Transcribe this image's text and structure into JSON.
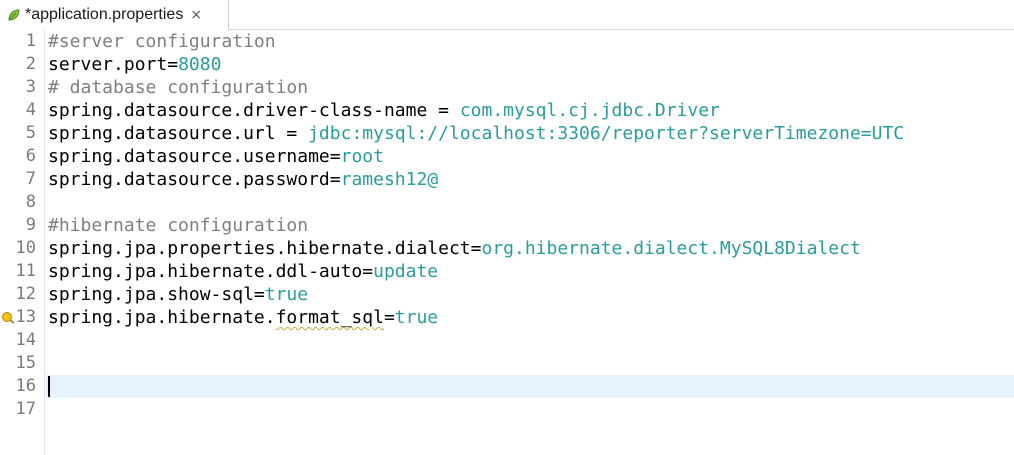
{
  "tab": {
    "title": "*application.properties",
    "close_glyph": "×",
    "icon": "properties-file-icon"
  },
  "lines": [
    {
      "n": "1",
      "comment": "#server configuration"
    },
    {
      "n": "2",
      "key": "server.port",
      "sep": "=",
      "value": "8080"
    },
    {
      "n": "3",
      "comment": "# database configuration"
    },
    {
      "n": "4",
      "key": "spring.datasource.driver-class-name",
      "sep": " = ",
      "value": "com.mysql.cj.jdbc.Driver"
    },
    {
      "n": "5",
      "key": "spring.datasource.url",
      "sep": " = ",
      "value": "jdbc:mysql://localhost:3306/reporter?serverTimezone=UTC"
    },
    {
      "n": "6",
      "key": "spring.datasource.username",
      "sep": "=",
      "value": "root"
    },
    {
      "n": "7",
      "key": "spring.datasource.password",
      "sep": "=",
      "value": "ramesh12@"
    },
    {
      "n": "8"
    },
    {
      "n": "9",
      "comment": "#hibernate configuration"
    },
    {
      "n": "10",
      "key": "spring.jpa.properties.hibernate.dialect",
      "sep": "=",
      "value": "org.hibernate.dialect.MySQL8Dialect"
    },
    {
      "n": "11",
      "key": "spring.jpa.hibernate.ddl-auto",
      "sep": "=",
      "value": "update"
    },
    {
      "n": "12",
      "key": "spring.jpa.show-sql",
      "sep": "=",
      "value": "true"
    },
    {
      "n": "13",
      "key_prefix": "spring.jpa.hibernate.",
      "key_squiggle": "format_sql",
      "sep": "=",
      "value": "true",
      "marker": "warning-marker-icon"
    },
    {
      "n": "14"
    },
    {
      "n": "15"
    },
    {
      "n": "16",
      "current": true
    },
    {
      "n": "17"
    }
  ],
  "colors": {
    "value": "#2a9c9c",
    "comment": "#7f7f7f",
    "current_line": "#e8f2fe"
  }
}
